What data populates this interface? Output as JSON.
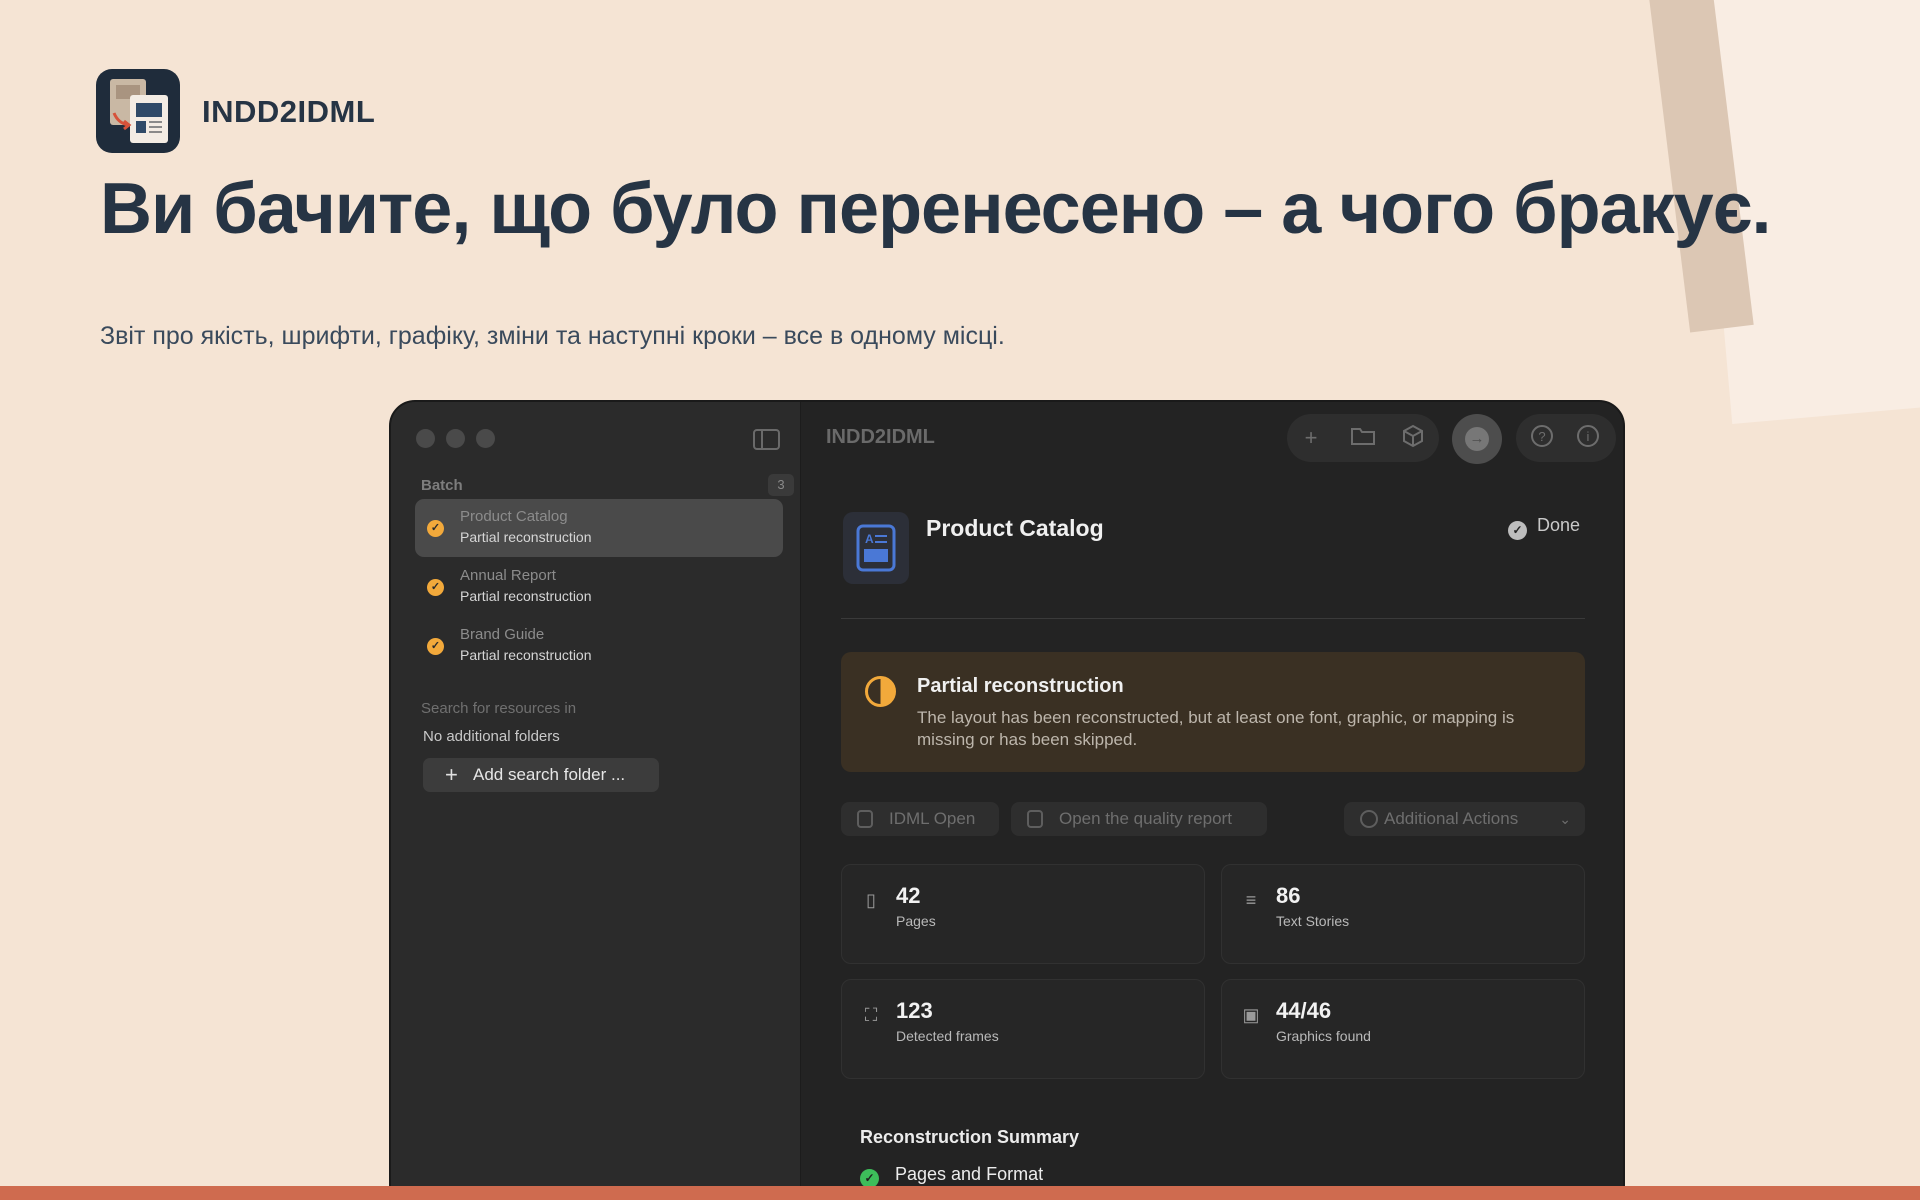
{
  "brand": {
    "app_name": "INDD2IDML"
  },
  "hero": {
    "headline": "Ви бачите, що було перенесено – а чого бракує.",
    "subline": "Звіт про якість, шрифти, графіку, зміни та наступні кроки – все в одному місці."
  },
  "window": {
    "title": "INDD2IDML",
    "sidebar": {
      "batch_label": "Batch",
      "batch_count": "3",
      "items": [
        {
          "title": "Product Catalog",
          "status": "Partial reconstruction"
        },
        {
          "title": "Annual Report",
          "status": "Partial reconstruction"
        },
        {
          "title": "Brand Guide",
          "status": "Partial reconstruction"
        }
      ],
      "search_label": "Search for resources in",
      "no_folders": "No additional folders",
      "add_folder": "Add search folder ..."
    },
    "document": {
      "title": "Product Catalog",
      "state": "Done"
    },
    "banner": {
      "title": "Partial reconstruction",
      "text": "The layout has been reconstructed, but at least one font, graphic, or mapping is missing or has been skipped."
    },
    "actions": {
      "idml_open": "IDML Open",
      "quality_report": "Open the quality report",
      "additional": "Additional Actions"
    },
    "stats": [
      {
        "value": "42",
        "label": "Pages"
      },
      {
        "value": "86",
        "label": "Text Stories"
      },
      {
        "value": "123",
        "label": "Detected frames"
      },
      {
        "value": "44/46",
        "label": "Graphics found"
      }
    ],
    "summary": {
      "title": "Reconstruction Summary",
      "items": [
        {
          "label": "Pages and Format"
        }
      ]
    }
  },
  "colors": {
    "background": "#f5e4d4",
    "ink": "#263444",
    "accent_orange": "#f2a93b",
    "success_green": "#3dbd5a",
    "bottom_strip": "#cf6b4f"
  }
}
